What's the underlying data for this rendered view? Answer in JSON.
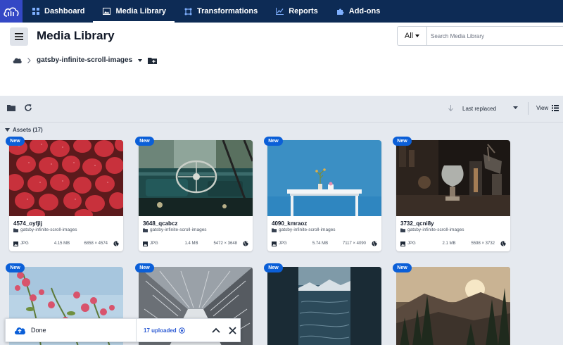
{
  "nav": {
    "logo_icon": "cloud-icon",
    "items": [
      {
        "label": "Dashboard",
        "icon": "grid-icon",
        "active": false
      },
      {
        "label": "Media Library",
        "icon": "image-icon",
        "active": true
      },
      {
        "label": "Transformations",
        "icon": "transform-icon",
        "active": false
      },
      {
        "label": "Reports",
        "icon": "chart-icon",
        "active": false
      },
      {
        "label": "Add-ons",
        "icon": "puzzle-icon",
        "active": false
      }
    ]
  },
  "header": {
    "title": "Media Library",
    "search": {
      "filter_label": "All",
      "placeholder": "Search Media Library"
    },
    "breadcrumb": {
      "folder": "gatsby-infinite-scroll-images"
    }
  },
  "toolbar": {
    "sort_label": "Last replaced",
    "view_label": "View"
  },
  "assets": {
    "heading": "Assets (17)",
    "badge_label": "New",
    "cards": [
      {
        "name": "4574_oyfjlj",
        "folder": "gatsby-infinite-scroll-images",
        "format": "JPG",
        "size": "4.15 MB",
        "dimensions": "6858 × 4574"
      },
      {
        "name": "3648_qcabcz",
        "folder": "gatsby-infinite-scroll-images",
        "format": "JPG",
        "size": "1.4 MB",
        "dimensions": "5472 × 3648"
      },
      {
        "name": "4090_kmraoz",
        "folder": "gatsby-infinite-scroll-images",
        "format": "JPG",
        "size": "5.74 MB",
        "dimensions": "7117 × 4090"
      },
      {
        "name": "3732_qcni8y",
        "folder": "gatsby-infinite-scroll-images",
        "format": "JPG",
        "size": "2.1 MB",
        "dimensions": "5598 × 3732"
      }
    ]
  },
  "upload": {
    "status": "Done",
    "count": "17 uploaded"
  },
  "colors": {
    "nav_bg": "#0d2b55",
    "logo_bg": "#3448c5",
    "accent": "#0b5fd8",
    "upload_link": "#2d5bd3"
  }
}
